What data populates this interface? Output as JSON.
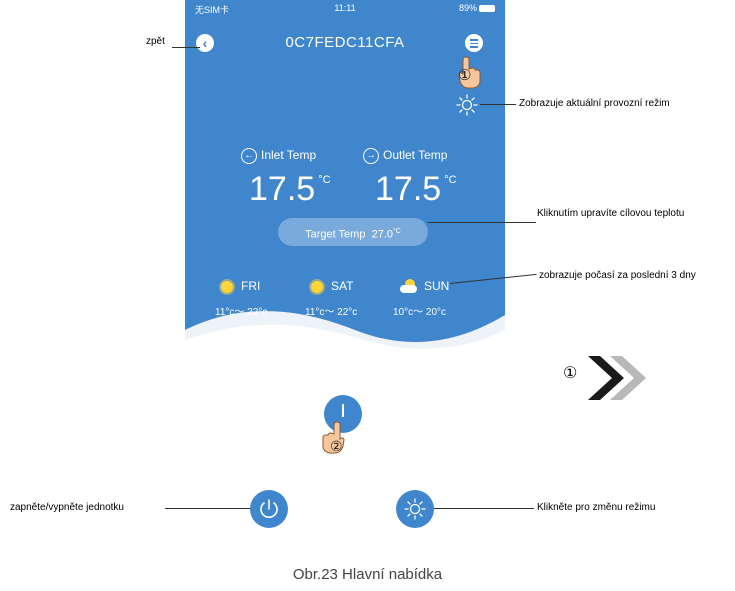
{
  "status_bar": {
    "carrier": "无SIM卡",
    "time": "11:11",
    "battery": "89%"
  },
  "header": {
    "title": "0C7FEDC11CFA"
  },
  "temps": {
    "inlet_label": "Inlet Temp",
    "outlet_label": "Outlet Temp",
    "inlet_value": "17.5",
    "outlet_value": "17.5",
    "unit": "°C"
  },
  "target": {
    "label": "Target Temp",
    "value": "27.0",
    "unit": "°C"
  },
  "weather": [
    {
      "day": "FRI",
      "range": "11°c～ 22°c",
      "icon": "sun-icon"
    },
    {
      "day": "SAT",
      "range": "11°c～ 22°c",
      "icon": "sun-icon"
    },
    {
      "day": "SUN",
      "range": "10°c～ 20°c",
      "icon": "cloud-sun-icon"
    }
  ],
  "callouts": {
    "step1": "①",
    "step2": "②",
    "back": "zpět",
    "mode": "Zobrazuje aktuální provozní režim",
    "target": "Kliknutím upravíte cílovou teplotu",
    "weather": "zobrazuje počasí za poslední 3 dny",
    "power": "zapněte/vypněte jednotku",
    "mode_change": "Klikněte pro změnu režimu"
  },
  "caption": "Obr.23 Hlavní nabídka",
  "colors": {
    "primary": "#3f86cc",
    "sun": "#ffd43b"
  }
}
